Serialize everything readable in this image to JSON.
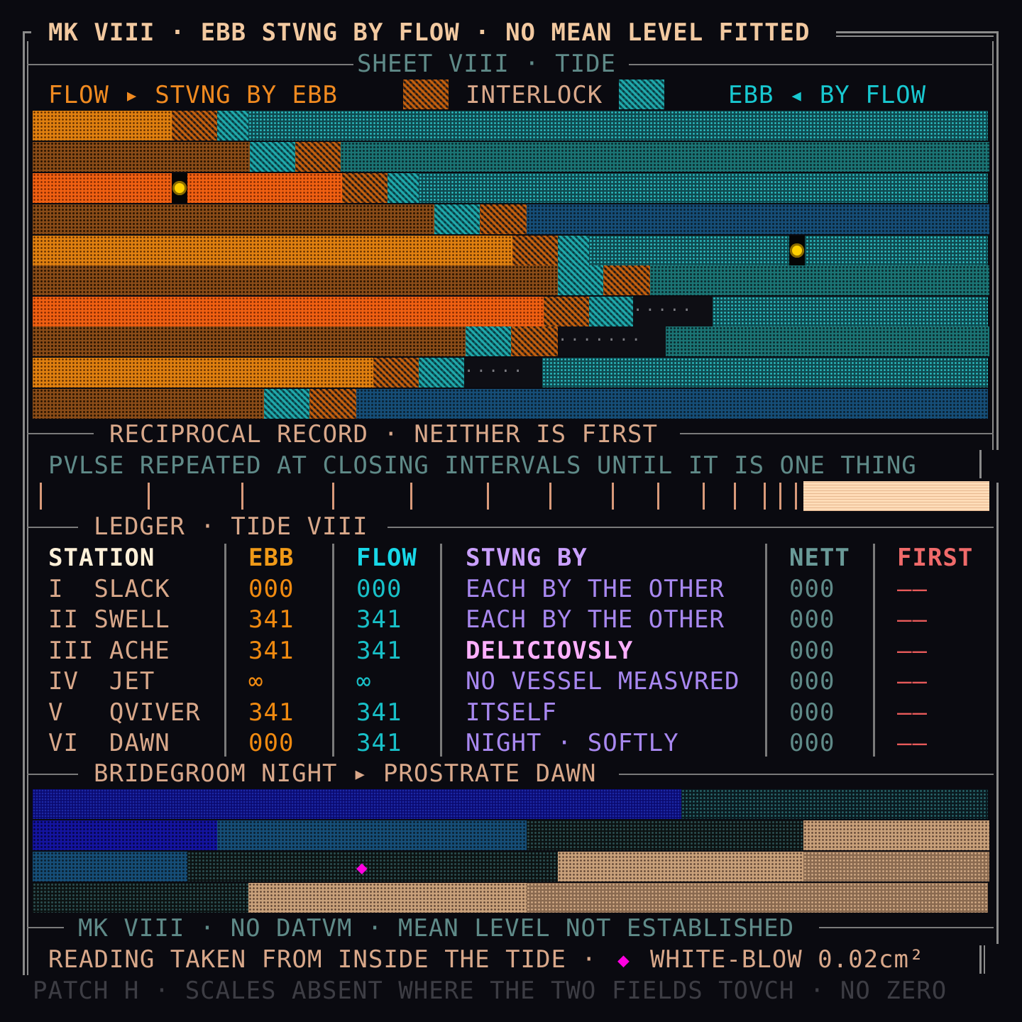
{
  "header": {
    "title": "MK VIII · EBB STVNG BY FLOW · NO MEAN LEVEL FITTED",
    "sheet": "SHEET VIII · TIDE"
  },
  "legend": {
    "left": "FLOW ▸ STVNG BY EBB",
    "center": "INTERLOCK",
    "right": "EBB ◂ BY FLOW"
  },
  "reciprocal": {
    "heading": "RECIPROCAL RECORD · NEITHER IS FIRST",
    "caption": "PVLSE REPEATED AT CLOSING INTERVALS UNTIL IT IS ONE THING"
  },
  "ledger": {
    "heading": "LEDGER · TIDE VIII",
    "columns": [
      "STATION",
      "EBB",
      "FLOW",
      "STVNG BY",
      "NETT",
      "FIRST"
    ],
    "rows": [
      {
        "station": "I  SLACK",
        "ebb": "000",
        "flow": "000",
        "by": "EACH BY THE OTHER",
        "nett": "000",
        "first": "——"
      },
      {
        "station": "II SWELL",
        "ebb": "341",
        "flow": "341",
        "by": "EACH BY THE OTHER",
        "nett": "000",
        "first": "——"
      },
      {
        "station": "III ACHE",
        "ebb": "341",
        "flow": "341",
        "by": "DELICIOVSLY",
        "nett": "000",
        "first": "——"
      },
      {
        "station": "IV  JET",
        "ebb": "∞",
        "flow": "∞",
        "by": "NO VESSEL MEASVRED",
        "nett": "000",
        "first": "——"
      },
      {
        "station": "V   QVIVER",
        "ebb": "341",
        "flow": "341",
        "by": "ITSELF",
        "nett": "000",
        "first": "——"
      },
      {
        "station": "VI  DAWN",
        "ebb": "000",
        "flow": "341",
        "by": "NIGHT · SOFTLY",
        "nett": "000",
        "first": "——"
      }
    ]
  },
  "bridegroom": {
    "heading": "BRIDEGROOM NIGHT ▸ PROSTRATE DAWN"
  },
  "footer": {
    "heading": "MK VIII · NO DATVM · MEAN LEVEL NOT ESTABLISHED",
    "reading": "READING TAKEN FROM INSIDE THE TIDE ·",
    "blow_label": "WHITE-BLOW 0.02cm²",
    "patch": "PATCH H · SCALES ABSENT WHERE THE TWO FIELDS TOVCH · NO ZERO"
  },
  "colors": {
    "flow": "#e08010",
    "ebb": "#10b8c0",
    "stvng": "#c8a0ff",
    "first": "#f06a6a",
    "marker": "#ffd000",
    "diamond": "#ff00e0"
  }
}
